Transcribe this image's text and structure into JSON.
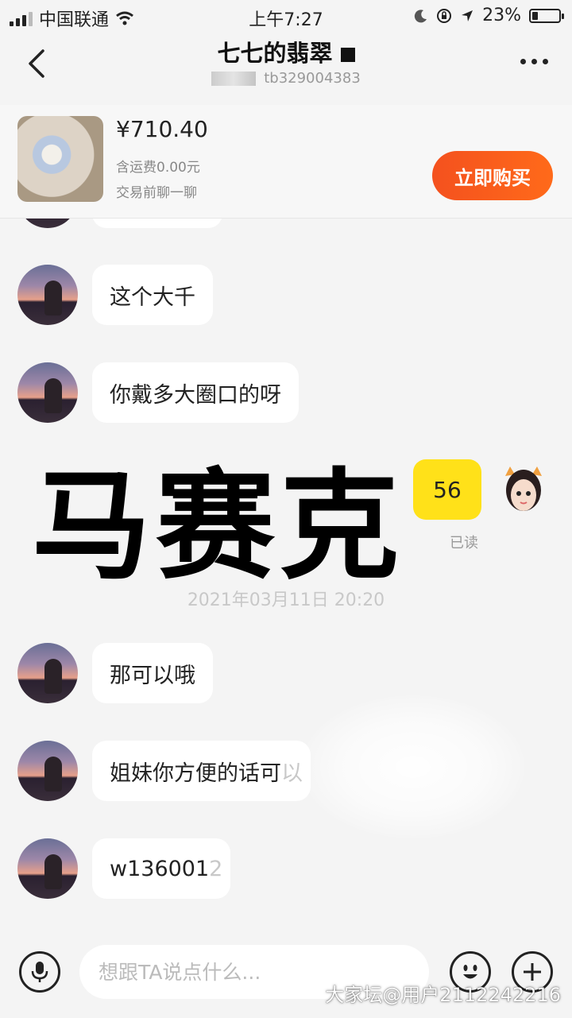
{
  "status_bar": {
    "carrier": "中国联通",
    "time": "上午7:27",
    "battery": "23%",
    "battery_level": 0.23
  },
  "header": {
    "title": "七七的翡翠",
    "subtitle": "tb329004383"
  },
  "product": {
    "price": "¥710.40",
    "shipping": "含运费0.00元",
    "note": "交易前聊一聊",
    "buy_label": "立即购买"
  },
  "messages": [
    {
      "text": "这个大千"
    },
    {
      "text": "你戴多大圈口的呀"
    },
    {
      "text": "那可以哦"
    },
    {
      "text": "姐妹你方便的话可以",
      "visible": "姐妹你方便的话可",
      "tail": "以"
    },
    {
      "text": "w1360012",
      "visible": "w136001",
      "tail": "2"
    }
  ],
  "my_message": {
    "text": "56",
    "status": "已读"
  },
  "timestamp": "2021年03月11日 20:20",
  "overlay": "马赛克",
  "input": {
    "placeholder": "想跟TA说点什么..."
  },
  "watermark": "大家坛@用户2112242216",
  "colors": {
    "accent": "#ff5a1f",
    "my_bubble": "#ffe119",
    "background": "#f4f4f4"
  }
}
